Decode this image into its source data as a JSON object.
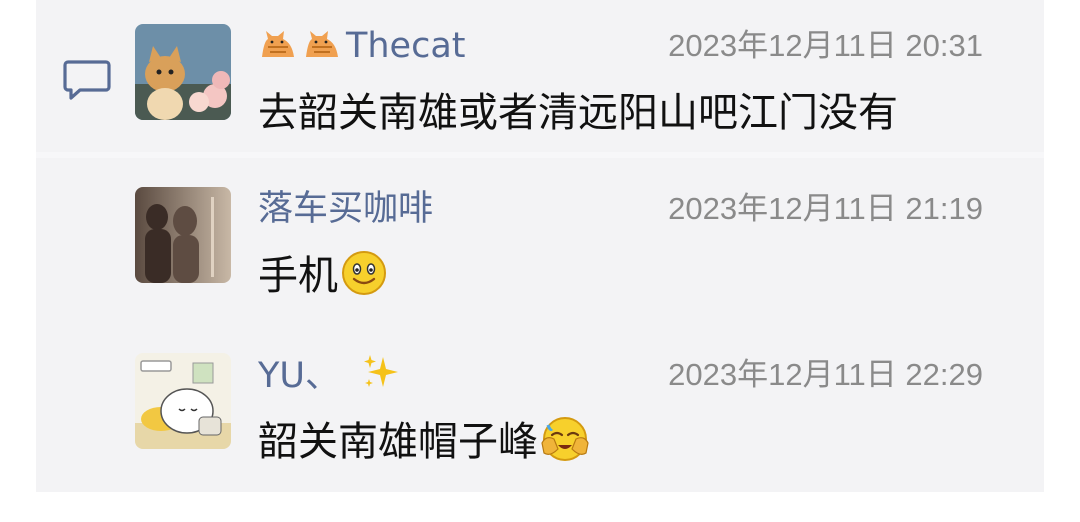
{
  "comments": [
    {
      "author": "Thecat",
      "author_prefix_icons": [
        "cat-emoji",
        "cat-emoji"
      ],
      "time": "2023年12月11日 20:31",
      "text": "去韶关南雄或者清远阳山吧江门没有",
      "avatar": "cat-with-flowers-avatar"
    },
    {
      "author": "落车买咖啡",
      "time": "2023年12月11日 21:19",
      "text": "手机",
      "text_suffix_emoji": "smiling-face-emoji",
      "avatar": "couple-shadow-avatar"
    },
    {
      "author": "YU、",
      "author_suffix_emoji": "sparkles-emoji",
      "time": "2023年12月11日 22:29",
      "text": "韶关南雄帽子峰",
      "text_suffix_emoji": "facepalm-emoji",
      "avatar": "cartoon-sleeping-avatar"
    }
  ],
  "colors": {
    "name": "#576b95",
    "time": "#8a8a8a",
    "panel": "#f3f3f5",
    "text": "#111111"
  }
}
